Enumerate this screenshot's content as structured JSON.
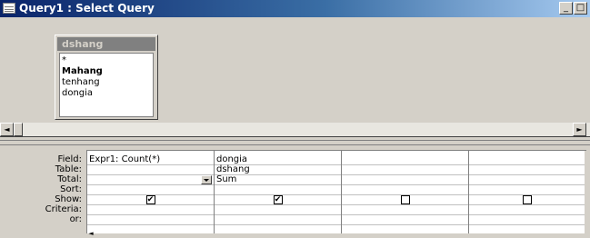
{
  "window": {
    "title": "Query1 : Select Query",
    "minimize_glyph": "_",
    "restore_glyph": "□"
  },
  "table_box": {
    "name": "dshang",
    "fields": [
      {
        "label": "*",
        "key": false
      },
      {
        "label": "Mahang",
        "key": true
      },
      {
        "label": "tenhang",
        "key": false
      },
      {
        "label": "dongia",
        "key": false
      }
    ]
  },
  "grid": {
    "row_labels": {
      "field": "Field:",
      "table": "Table:",
      "total": "Total:",
      "sort": "Sort:",
      "show": "Show:",
      "criteria": "Criteria:",
      "or": "or:"
    },
    "columns": [
      {
        "field": "Expr1: Count(*)",
        "table": "",
        "total": "",
        "show": true
      },
      {
        "field": "dongia",
        "table": "dshang",
        "total": "Sum",
        "show": true
      },
      {
        "field": "",
        "table": "",
        "total": "",
        "show": false
      },
      {
        "field": "",
        "table": "",
        "total": "",
        "show": false
      }
    ]
  },
  "icons": {
    "window_icon": "query-icon",
    "scroll_left": "◄",
    "scroll_right": "►",
    "checkmark": "✔"
  }
}
